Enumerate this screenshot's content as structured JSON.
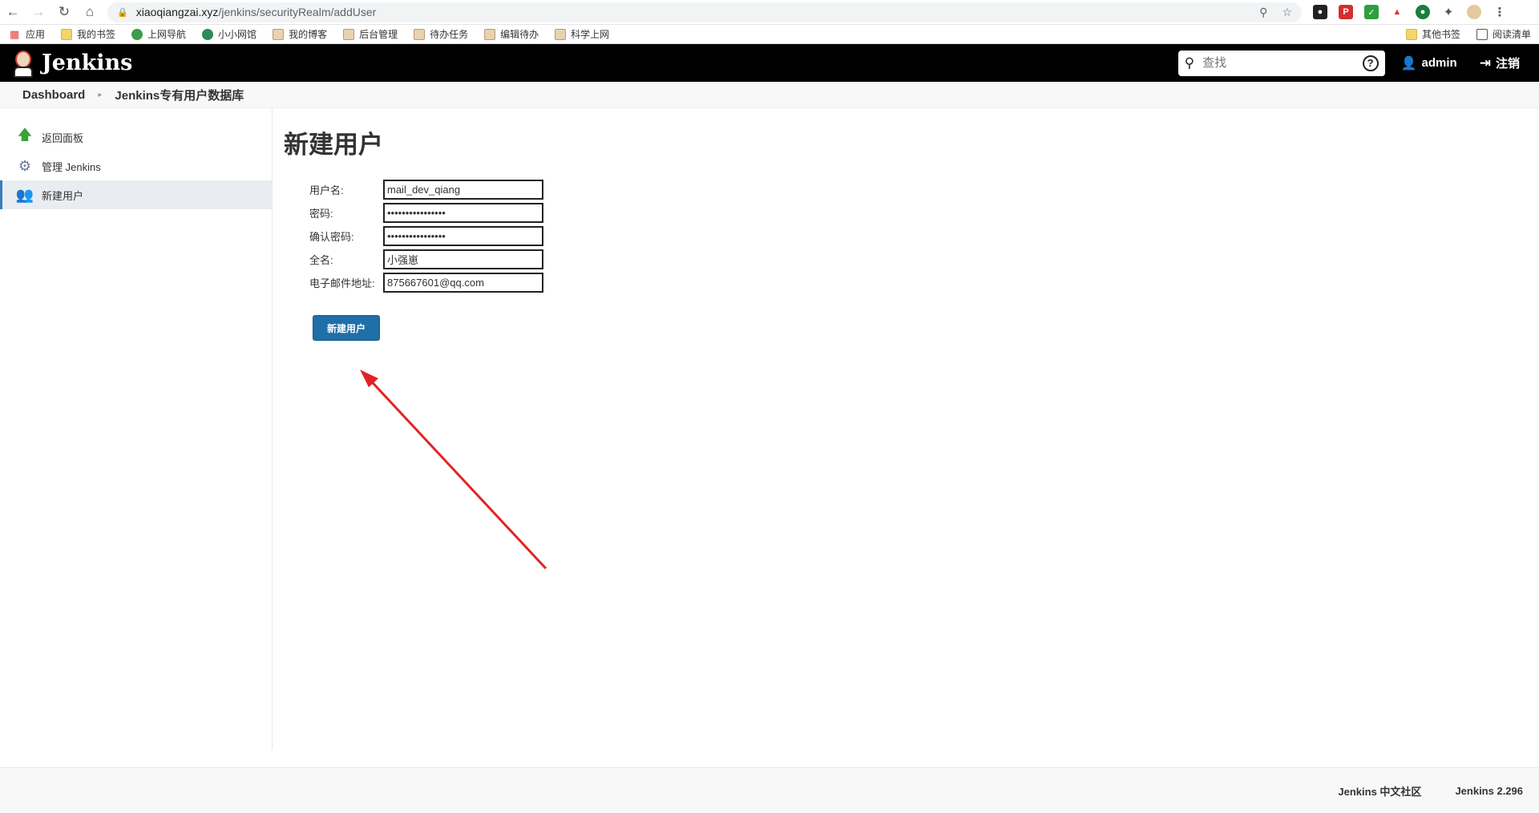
{
  "browser": {
    "url_host": "xiaoqiangzai.xyz",
    "url_path": "/jenkins/securityRealm/addUser",
    "bookmarks": [
      {
        "label": "应用",
        "icon": "apps-icon"
      },
      {
        "label": "我的书签",
        "icon": "folder-icon"
      },
      {
        "label": "上网导航",
        "icon": "page-icon"
      },
      {
        "label": "小小网馆",
        "icon": "page-icon"
      },
      {
        "label": "我的博客",
        "icon": "page-icon"
      },
      {
        "label": "后台管理",
        "icon": "page-icon"
      },
      {
        "label": "待办任务",
        "icon": "page-icon"
      },
      {
        "label": "编辑待办",
        "icon": "page-icon"
      },
      {
        "label": "科学上网",
        "icon": "page-icon"
      }
    ],
    "bookmarks_right": [
      {
        "label": "其他书签"
      },
      {
        "label": "阅读清单"
      }
    ]
  },
  "header": {
    "logo_text": "Jenkins",
    "search_placeholder": "查找",
    "user": "admin",
    "logout": "注销"
  },
  "breadcrumb": {
    "items": [
      "Dashboard",
      "Jenkins专有用户数据库"
    ]
  },
  "sidebar": {
    "items": [
      {
        "label": "返回面板",
        "icon": "up-arrow-icon"
      },
      {
        "label": "管理 Jenkins",
        "icon": "gear-icon"
      },
      {
        "label": "新建用户",
        "icon": "users-icon",
        "active": true
      }
    ]
  },
  "page": {
    "title": "新建用户",
    "fields": [
      {
        "label": "用户名:",
        "value": "mail_dev_qiang",
        "type": "text"
      },
      {
        "label": "密码:",
        "value": "••••••••••••••••",
        "type": "password"
      },
      {
        "label": "确认密码:",
        "value": "••••••••••••••••",
        "type": "password"
      },
      {
        "label": "全名:",
        "value": "小强崽",
        "type": "text"
      },
      {
        "label": "电子邮件地址:",
        "value": "875667601@qq.com",
        "type": "text"
      }
    ],
    "submit_label": "新建用户"
  },
  "footer": {
    "community": "Jenkins 中文社区",
    "version": "Jenkins 2.296"
  },
  "colors": {
    "header_bg": "#000000",
    "accent_button": "#1f6fa8",
    "annotation_arrow": "#e02424"
  }
}
